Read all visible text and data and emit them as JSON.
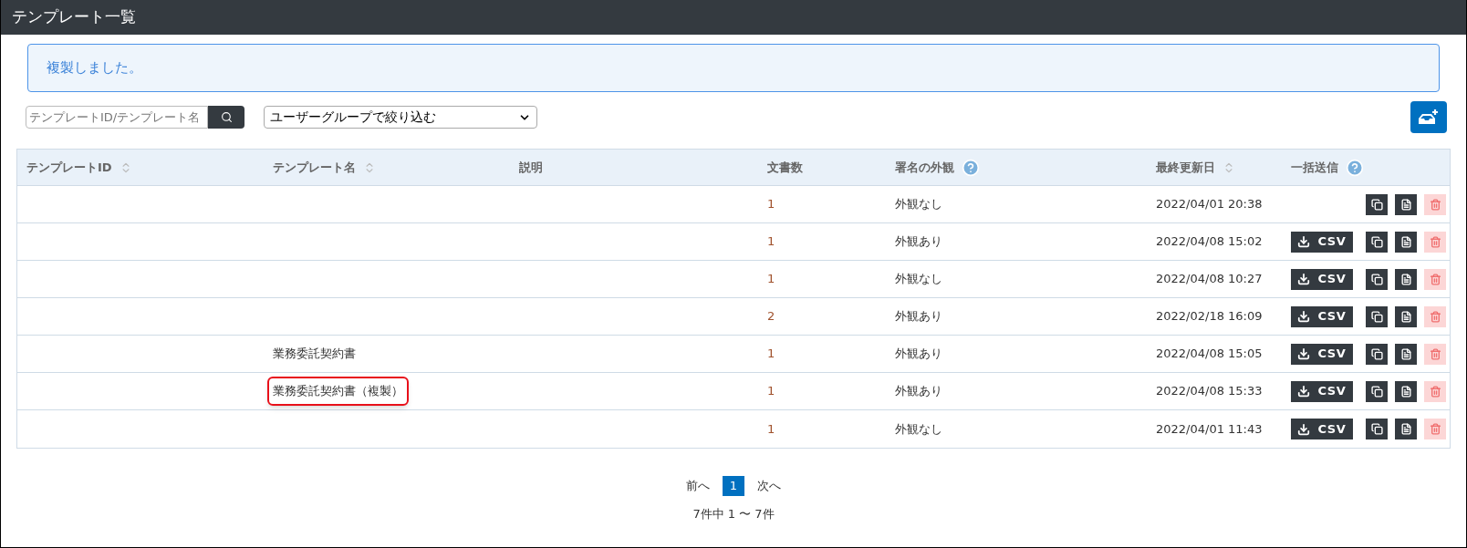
{
  "window": {
    "title": "テンプレート一覧"
  },
  "alert": {
    "message": "複製しました。"
  },
  "search": {
    "placeholder": "テンプレートID/テンプレート名"
  },
  "group_filter": {
    "value": "ユーザーグループで絞り込む"
  },
  "table": {
    "columns": [
      {
        "label": "テンプレートID",
        "kind": "sortable"
      },
      {
        "label": "テンプレート名",
        "kind": "sortable"
      },
      {
        "label": "説明",
        "kind": "plain"
      },
      {
        "label": "文書数",
        "kind": "plain"
      },
      {
        "label": "署名の外観",
        "kind": "help"
      },
      {
        "label": "最終更新日",
        "kind": "sortable"
      },
      {
        "label": "一括送信",
        "kind": "help"
      }
    ],
    "rows": [
      {
        "name": "",
        "count": "1",
        "appearance": "外観なし",
        "updated": "2022/04/01 20:38",
        "highlighted": false,
        "delete_disabled": true
      },
      {
        "name": "",
        "count": "1",
        "appearance": "外観あり",
        "updated": "2022/04/08 15:02",
        "csv_button": "CSV",
        "highlighted": false,
        "delete_disabled": true
      },
      {
        "name": "",
        "count": "1",
        "appearance": "外観なし",
        "updated": "2022/04/08 10:27",
        "csv_button": "CSV",
        "highlighted": false,
        "delete_disabled": true
      },
      {
        "name": "",
        "count": "2",
        "appearance": "外観あり",
        "updated": "2022/02/18 16:09",
        "csv_button": "CSV",
        "highlighted": false,
        "delete_disabled": true
      },
      {
        "name": "業務委託契約書",
        "count": "1",
        "appearance": "外観あり",
        "updated": "2022/04/08 15:05",
        "csv_button": "CSV",
        "highlighted": false,
        "delete_disabled": true
      },
      {
        "name": "業務委託契約書（複製）",
        "count": "1",
        "appearance": "外観あり",
        "updated": "2022/04/08 15:33",
        "csv_button": "CSV",
        "highlighted": true,
        "delete_disabled": true
      },
      {
        "name": "",
        "count": "1",
        "appearance": "外観なし",
        "updated": "2022/04/01 11:43",
        "csv_button": "CSV",
        "highlighted": false,
        "delete_disabled": true
      }
    ]
  },
  "pagination": {
    "prev": "前へ",
    "pages": [
      {
        "label": "1",
        "selected": true
      }
    ],
    "next": "次へ",
    "summary": "7件中 1 〜 7件"
  }
}
